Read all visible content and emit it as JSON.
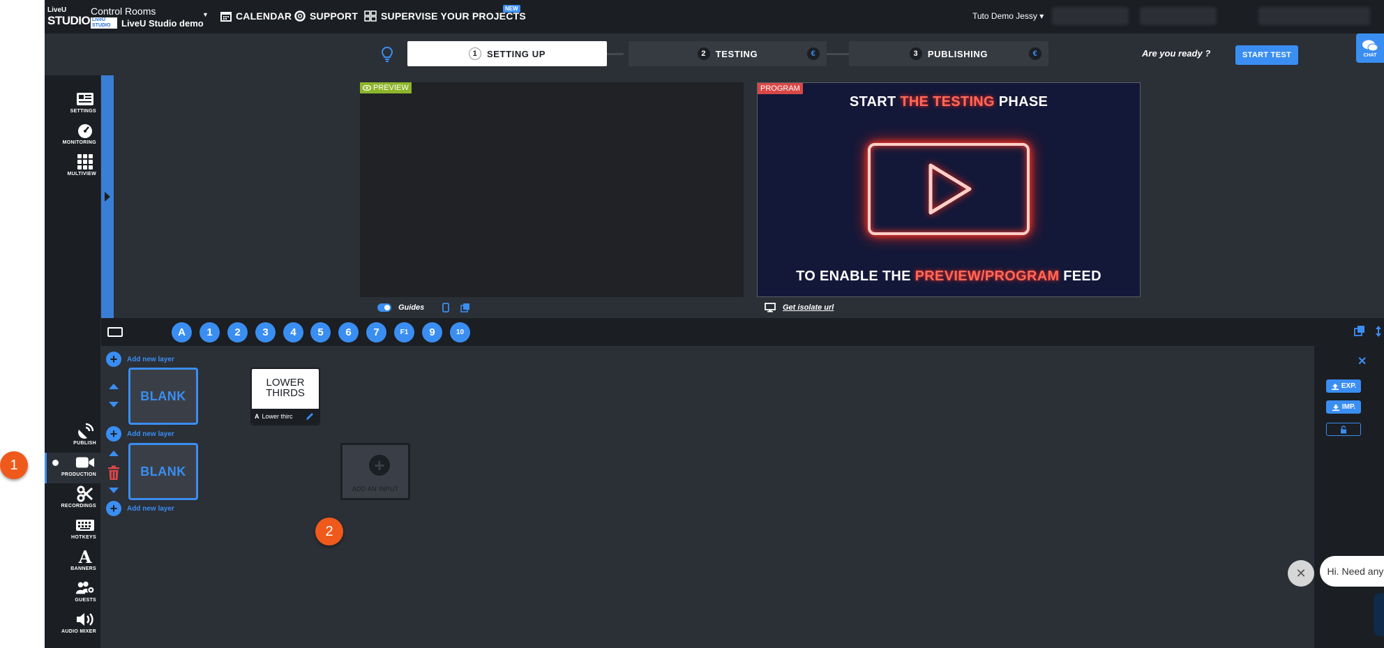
{
  "brand": {
    "top": "LiveU",
    "main": "STUDIO"
  },
  "room": {
    "title": "Control Rooms",
    "mini_logo": "LiveU STUDIO",
    "name": "LiveU Studio demo"
  },
  "nav": {
    "calendar": "CALENDAR",
    "support": "SUPPORT",
    "supervise": "SUPERVISE YOUR PROJECTS",
    "new_badge": "NEW"
  },
  "user": {
    "name": "Tuto Demo Jessy"
  },
  "steps": [
    {
      "num": "1",
      "label": "SETTING UP"
    },
    {
      "num": "2",
      "label": "TESTING",
      "currency": "€"
    },
    {
      "num": "3",
      "label": "PUBLISHING",
      "currency": "€"
    }
  ],
  "ready_text": "Are you ready ?",
  "start_test": "START TEST",
  "chat_label": "CHAT",
  "sidebar_top": [
    {
      "label": "SETTINGS",
      "icon": "settings-icon"
    },
    {
      "label": "MONITORING",
      "icon": "gauge-icon"
    },
    {
      "label": "MULTIVIEW",
      "icon": "grid-icon"
    }
  ],
  "sidebar_bottom": [
    {
      "label": "PUBLISH",
      "icon": "satellite-icon"
    },
    {
      "label": "PRODUCTION",
      "icon": "camera-icon"
    },
    {
      "label": "RECORDINGS",
      "icon": "scissors-icon"
    },
    {
      "label": "HOTKEYS",
      "icon": "keyboard-icon"
    },
    {
      "label": "BANNERS",
      "icon": "font-icon"
    },
    {
      "label": "GUESTS",
      "icon": "guests-icon"
    },
    {
      "label": "AUDIO MIXER",
      "icon": "speaker-icon"
    }
  ],
  "preview": {
    "tag": "PREVIEW",
    "guides": "Guides"
  },
  "program": {
    "tag": "PROGRAM",
    "line1_a": "START ",
    "line1_b": "THE TESTING",
    "line1_c": " PHASE",
    "line2_a": "TO ENABLE THE ",
    "line2_b": "PREVIEW/PROGRAM",
    "line2_c": " FEED",
    "isolate_link": "Get isolate url"
  },
  "hotkeys": [
    "A",
    "1",
    "2",
    "3",
    "4",
    "5",
    "6",
    "7",
    "F1",
    "9",
    "10"
  ],
  "layers": {
    "add_label": "Add new layer",
    "blank": "BLANK",
    "lower_thirds_title": "LOWER THIRDS",
    "lower_thirds_name": "Lower thirc",
    "add_input": "ADD AN INPUT"
  },
  "right_panel": {
    "exp": "EXP.",
    "imp": "IMP."
  },
  "help": {
    "message": "Hi. Need any help?",
    "close": "✕"
  },
  "markers": [
    "1",
    "2"
  ],
  "colors": {
    "accent": "#3a8ef2",
    "preview_tag": "#8db52a",
    "program_tag": "#d94747",
    "marker": "#ef5a1c"
  }
}
